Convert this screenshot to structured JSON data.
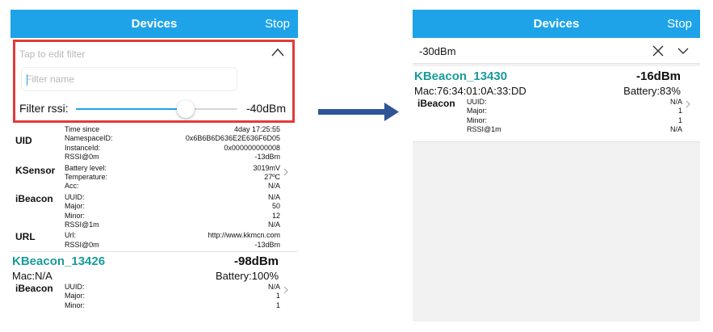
{
  "navbar": {
    "title": "Devices",
    "stop": "Stop"
  },
  "left": {
    "filter": {
      "hint": "Tap to edit filter",
      "name_placeholder": "Filter name",
      "rssi_label": "Filter rssi:",
      "rssi_value": "-40dBm",
      "slider_fraction": 0.68
    },
    "top_beacon": {
      "groups": [
        {
          "name": "",
          "rows": [
            {
              "k": "Time since",
              "v": "4day 17:25:55"
            }
          ]
        },
        {
          "name": "UID",
          "rows": [
            {
              "k": "NamespaceID:",
              "v": "0x6B6B6D636E2E636F6D05"
            },
            {
              "k": "InstanceId:",
              "v": "0x000000000008"
            },
            {
              "k": "RSSI@0m",
              "v": "-13dBm"
            }
          ]
        },
        {
          "name": "KSensor",
          "rows": [
            {
              "k": "Battery level:",
              "v": "3019mV"
            },
            {
              "k": "Temperature:",
              "v": "27ºC"
            },
            {
              "k": "Acc:",
              "v": "N/A"
            }
          ]
        },
        {
          "name": "iBeacon",
          "rows": [
            {
              "k": "UUID:",
              "v": "N/A"
            },
            {
              "k": "Major:",
              "v": "50"
            },
            {
              "k": "Minor:",
              "v": "12"
            },
            {
              "k": "RSSI@1m",
              "v": "N/A"
            }
          ]
        },
        {
          "name": "URL",
          "rows": [
            {
              "k": "Url:",
              "v": "http://www.kkmcn.com"
            },
            {
              "k": "RSSI@0m",
              "v": "-13dBm"
            }
          ]
        }
      ]
    },
    "beacon2": {
      "name": "KBeacon_13426",
      "rssi": "-98dBm",
      "mac": "Mac:N/A",
      "battery": "Battery:100%",
      "group": "iBeacon",
      "rows": [
        {
          "k": "UUID:",
          "v": "N/A"
        },
        {
          "k": "Major:",
          "v": "1"
        },
        {
          "k": "Minor:",
          "v": "1"
        }
      ]
    }
  },
  "right": {
    "filter_value": "-30dBm",
    "beacon": {
      "name": "KBeacon_13430",
      "rssi": "-16dBm",
      "mac": "Mac:76:34:01:0A:33:DD",
      "battery": "Battery:83%",
      "group": "iBeacon",
      "rows": [
        {
          "k": "UUID:",
          "v": "N/A"
        },
        {
          "k": "Major:",
          "v": "1"
        },
        {
          "k": "Minor:",
          "v": "1"
        },
        {
          "k": "RSSI@1m",
          "v": "N/A"
        }
      ]
    }
  },
  "colors": {
    "navbar": "#1fa3e8",
    "highlight": "#e23a3a",
    "beacon_name": "#1a9a9a",
    "arrow": "#2f5597"
  },
  "icons": [
    "chevron-up-icon",
    "chevron-right-icon",
    "close-icon",
    "chevron-down-icon",
    "arrow-right-icon"
  ]
}
